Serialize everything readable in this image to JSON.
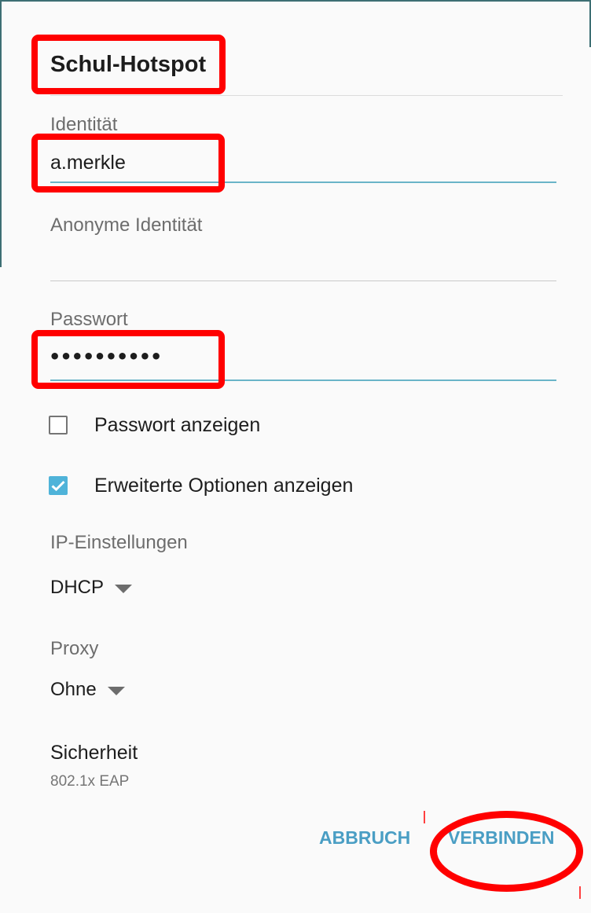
{
  "dialog": {
    "title": "Schul-Hotspot"
  },
  "fields": {
    "identity": {
      "label": "Identität",
      "value": "a.merkle"
    },
    "anonymous_identity": {
      "label": "Anonyme Identität",
      "value": ""
    },
    "password": {
      "label": "Passwort",
      "masked_value": "••••••••••"
    }
  },
  "options": {
    "show_password": {
      "label": "Passwort anzeigen",
      "checked": false
    },
    "advanced_options": {
      "label": "Erweiterte Optionen anzeigen",
      "checked": true
    }
  },
  "ip_settings": {
    "label": "IP-Einstellungen",
    "value": "DHCP"
  },
  "proxy": {
    "label": "Proxy",
    "value": "Ohne"
  },
  "security": {
    "label": "Sicherheit",
    "value": "802.1x EAP"
  },
  "actions": {
    "cancel": "ABBRUCH",
    "connect": "VERBINDEN"
  },
  "colors": {
    "accent": "#4fb3d9",
    "button_text": "#4a9ec4",
    "highlight": "#ff0000"
  }
}
